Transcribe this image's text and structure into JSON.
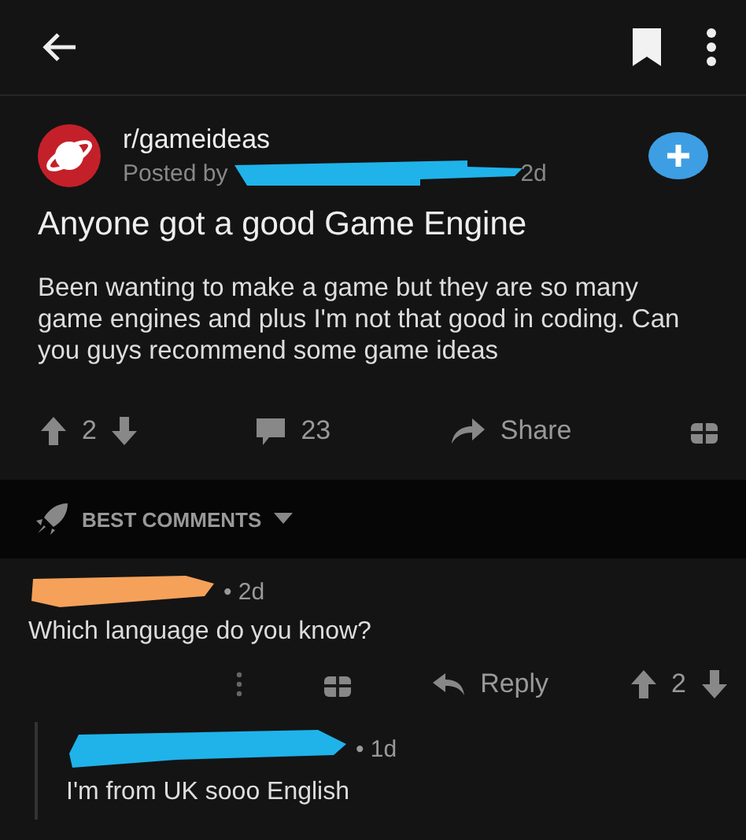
{
  "post": {
    "subreddit": "r/gameideas",
    "posted_by": "Posted by",
    "author_redaction": {
      "color": "#1fb3ea"
    },
    "age": "2d",
    "title": "Anyone got a good Game Engine",
    "body": "Been wanting to make a game but they are so many game engines and plus I'm not that good in coding. Can you guys recommend some game ideas",
    "score": "2",
    "comment_count": "23",
    "share_label": "Share"
  },
  "sort": {
    "label": "BEST COMMENTS"
  },
  "comments": [
    {
      "color": "#f5a15a",
      "age": "• 2d",
      "text": "Which language do you know?",
      "reply_label": "Reply",
      "score": "2",
      "children": [
        {
          "color": "#1fb3ea",
          "age": "• 1d",
          "text": "I'm from UK sooo English"
        }
      ]
    }
  ]
}
